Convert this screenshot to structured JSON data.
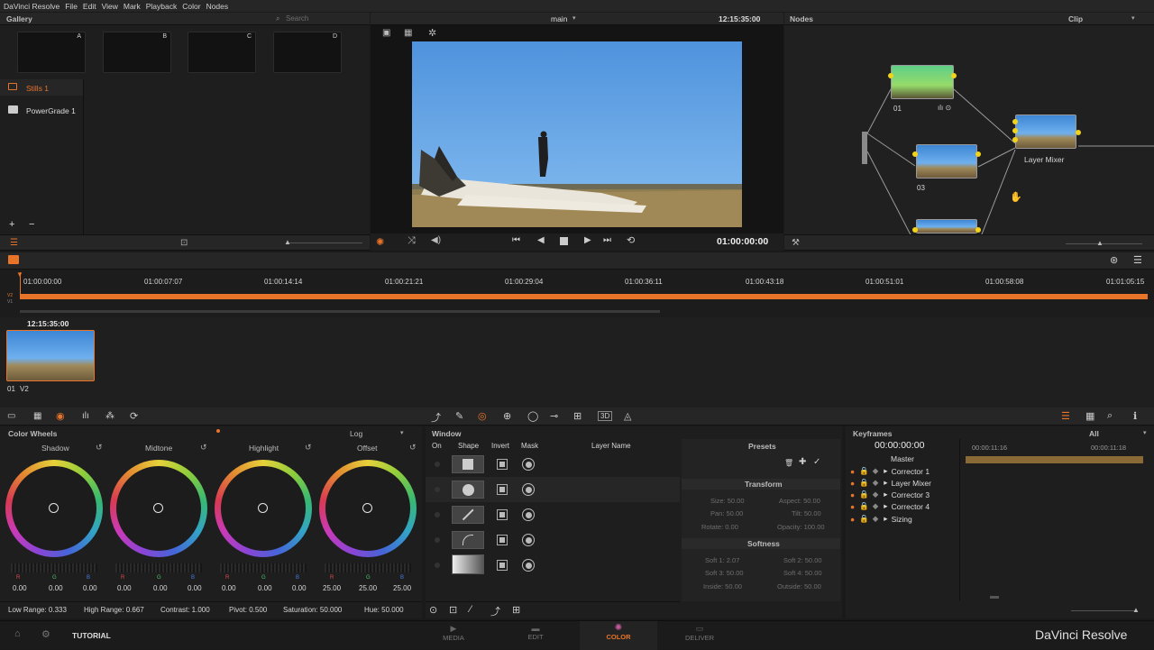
{
  "menubar": {
    "app": "DaVinci Resolve",
    "items": [
      "File",
      "Edit",
      "View",
      "Mark",
      "Playback",
      "Color",
      "Nodes"
    ]
  },
  "gallery": {
    "title": "Gallery",
    "search_placeholder": "Search",
    "stills": [
      "A",
      "B",
      "C",
      "D"
    ],
    "albums": [
      "Stills 1",
      "PowerGrade 1"
    ],
    "add": "+",
    "remove": "−"
  },
  "viewer": {
    "label": "main",
    "timecode_top": "12:15:35:00",
    "timecode": "01:00:00:00"
  },
  "nodes": {
    "title": "Nodes",
    "mode": "Clip",
    "n1": "01",
    "n3": "03",
    "mixer": "Layer Mixer"
  },
  "timeline": {
    "ticks": [
      "01:00:00:00",
      "01:00:07:07",
      "01:00:14:14",
      "01:00:21:21",
      "01:00:29:04",
      "01:00:36:11",
      "01:00:43:18",
      "01:00:51:01",
      "01:00:58:08",
      "01:01:05:15"
    ],
    "tracks": [
      "V2",
      "V1"
    ]
  },
  "clips": {
    "timecode": "12:15:35:00",
    "label": "01",
    "track": "V2"
  },
  "wheels": {
    "title": "Color Wheels",
    "mode": "Log",
    "items": [
      {
        "name": "Shadow",
        "r": "0.00",
        "g": "0.00",
        "b": "0.00"
      },
      {
        "name": "Midtone",
        "r": "0.00",
        "g": "0.00",
        "b": "0.00"
      },
      {
        "name": "Highlight",
        "r": "0.00",
        "g": "0.00",
        "b": "0.00"
      },
      {
        "name": "Offset",
        "r": "25.00",
        "g": "25.00",
        "b": "25.00"
      }
    ],
    "rgb": [
      "R",
      "G",
      "B"
    ],
    "footer": {
      "low": "Low Range: 0.333",
      "high": "High Range: 0.667",
      "contrast": "Contrast: 1.000",
      "pivot": "Pivot: 0.500",
      "saturation": "Saturation: 50.000",
      "hue": "Hue: 50.000"
    }
  },
  "window": {
    "title": "Window",
    "cols": [
      "On",
      "Shape",
      "Invert",
      "Mask",
      "Layer Name"
    ]
  },
  "presets": {
    "title": "Presets",
    "transform_title": "Transform",
    "transform": [
      "Size: 50.00",
      "Aspect: 50.00",
      "Pan: 50.00",
      "Tilt: 50.00",
      "Rotate: 0.00",
      "Opacity: 100.00"
    ],
    "softness_title": "Softness",
    "softness": [
      "Soft 1: 2.07",
      "Soft 2: 50.00",
      "Soft 3: 50.00",
      "Soft 4: 50.00",
      "Inside: 50.00",
      "Outside: 50.00"
    ]
  },
  "keyframes": {
    "title": "Keyframes",
    "filter": "All",
    "timecode": "00:00:00:00",
    "t1": "00:00:11:16",
    "t2": "00:00:11:18",
    "master": "Master",
    "rows": [
      "Corrector 1",
      "Layer Mixer",
      "Corrector 3",
      "Corrector 4",
      "Sizing"
    ]
  },
  "bottom": {
    "project": "TUTORIAL",
    "pages": [
      "MEDIA",
      "EDIT",
      "COLOR",
      "DELIVER"
    ],
    "brand": "DaVinci Resolve"
  },
  "colors": {
    "accent": "#e8742a",
    "active_page": "#e8742a",
    "node_dot": "#f3d21a"
  }
}
